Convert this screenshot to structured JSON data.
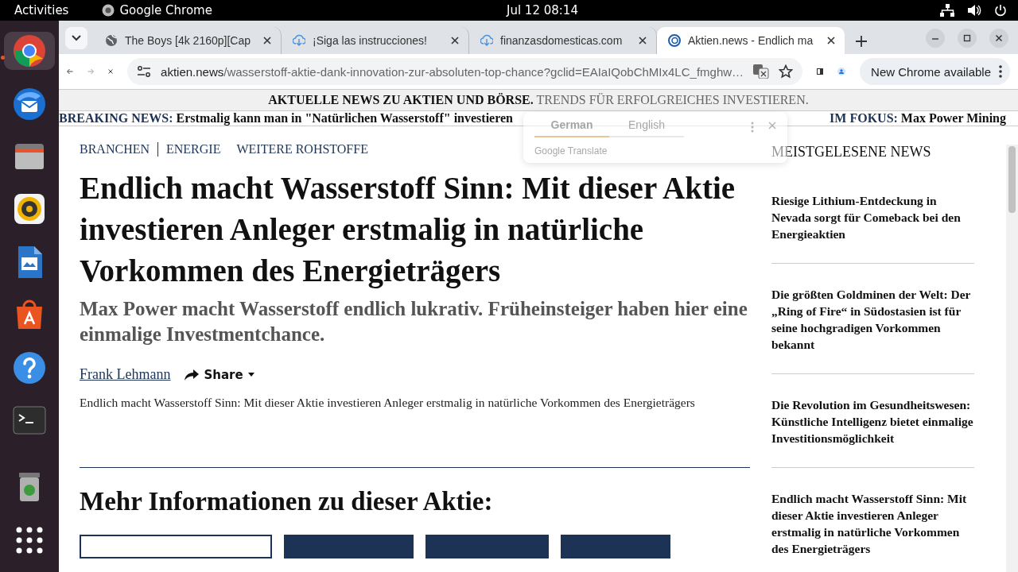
{
  "desktop": {
    "activities": "Activities",
    "app_name": "Google Chrome",
    "clock": "Jul 12  08:14"
  },
  "dock": {
    "items": [
      {
        "kind": "chrome",
        "running": true
      },
      {
        "kind": "mail",
        "running": false
      },
      {
        "kind": "files",
        "running": false
      },
      {
        "kind": "music",
        "running": false
      },
      {
        "kind": "writer",
        "running": false
      },
      {
        "kind": "store",
        "running": false
      },
      {
        "kind": "help",
        "running": false
      },
      {
        "kind": "terminal",
        "running": false
      },
      {
        "kind": "trash",
        "running": false
      },
      {
        "kind": "apps",
        "running": false
      }
    ]
  },
  "browser": {
    "tabs": [
      {
        "title": "The Boys [4k 2160p][Cap",
        "kind": "globe",
        "selected": false
      },
      {
        "title": "¡Siga las instrucciones!",
        "kind": "download",
        "selected": false
      },
      {
        "title": "finanzasdomesticas.com",
        "kind": "download",
        "selected": false
      },
      {
        "title": "Aktien.news - Endlich ma",
        "kind": "site",
        "selected": true
      }
    ],
    "url_host": "aktien.news",
    "url_path": "/wasserstoff-aktie-dank-innovation-zur-absoluten-top-chance?gclid=EAIaIQobChMIx4LC_fmghw…",
    "update_button": "New Chrome available"
  },
  "translate_popup": {
    "languages": [
      {
        "label": "German",
        "selected": true
      },
      {
        "label": "English",
        "selected": false
      }
    ],
    "brand": "Google Translate"
  },
  "page": {
    "banner_bold": "AKTUELLE NEWS ZU AKTIEN UND BÖRSE.",
    "banner_rest": "TRENDS FÜR ERFOLGREICHES INVESTIEREN.",
    "ticker": [
      {
        "label": "BREAKING NEWS:",
        "text": "Erstmalig kann man in \"Natürlichen Wasserstoff\" investieren"
      },
      {
        "label": "IM FOKUS:",
        "text": "Max Power Mining"
      }
    ],
    "categories": [
      "BRANCHEN",
      "ENERGIE",
      "WEITERE ROHSTOFFE"
    ],
    "title": "Endlich macht Wasserstoff Sinn: Mit dieser Aktie investieren Anleger erstmalig in natürliche Vorkommen des Energieträgers",
    "subtitle": "Max Power macht Wasserstoff endlich lukrativ. Früheinsteiger haben hier eine einmalige Investmentchance.",
    "author": "Frank Lehmann",
    "share": "Share",
    "image_alt": "Endlich macht Wasserstoff Sinn: Mit dieser Aktie investieren Anleger erstmalig in natürliche Vorkommen des Energieträgers",
    "more_heading": "Mehr Informationen zu dieser Aktie:",
    "info_buttons": [
      {
        "kind": "outline"
      },
      {
        "kind": "filled"
      },
      {
        "kind": "filled"
      },
      {
        "kind": "filled"
      }
    ],
    "sidebar": {
      "heading": "MEISTGELESENE NEWS",
      "items": [
        "Riesige Lithium-Entdeckung in Nevada sorgt für Comeback bei den Energieaktien",
        "Die größten Goldminen der Welt: Der „Ring of Fire“ in Südostasien ist für seine hochgradigen Vorkommen bekannt",
        "Die Revolution im Gesundheitswesen: Künstliche Intelligenz bietet einmalige Investitionsmöglichkeit",
        "Endlich macht Wasserstoff Sinn: Mit dieser Aktie investieren Anleger erstmalig in natürliche Vorkommen des Energieträgers"
      ]
    }
  }
}
